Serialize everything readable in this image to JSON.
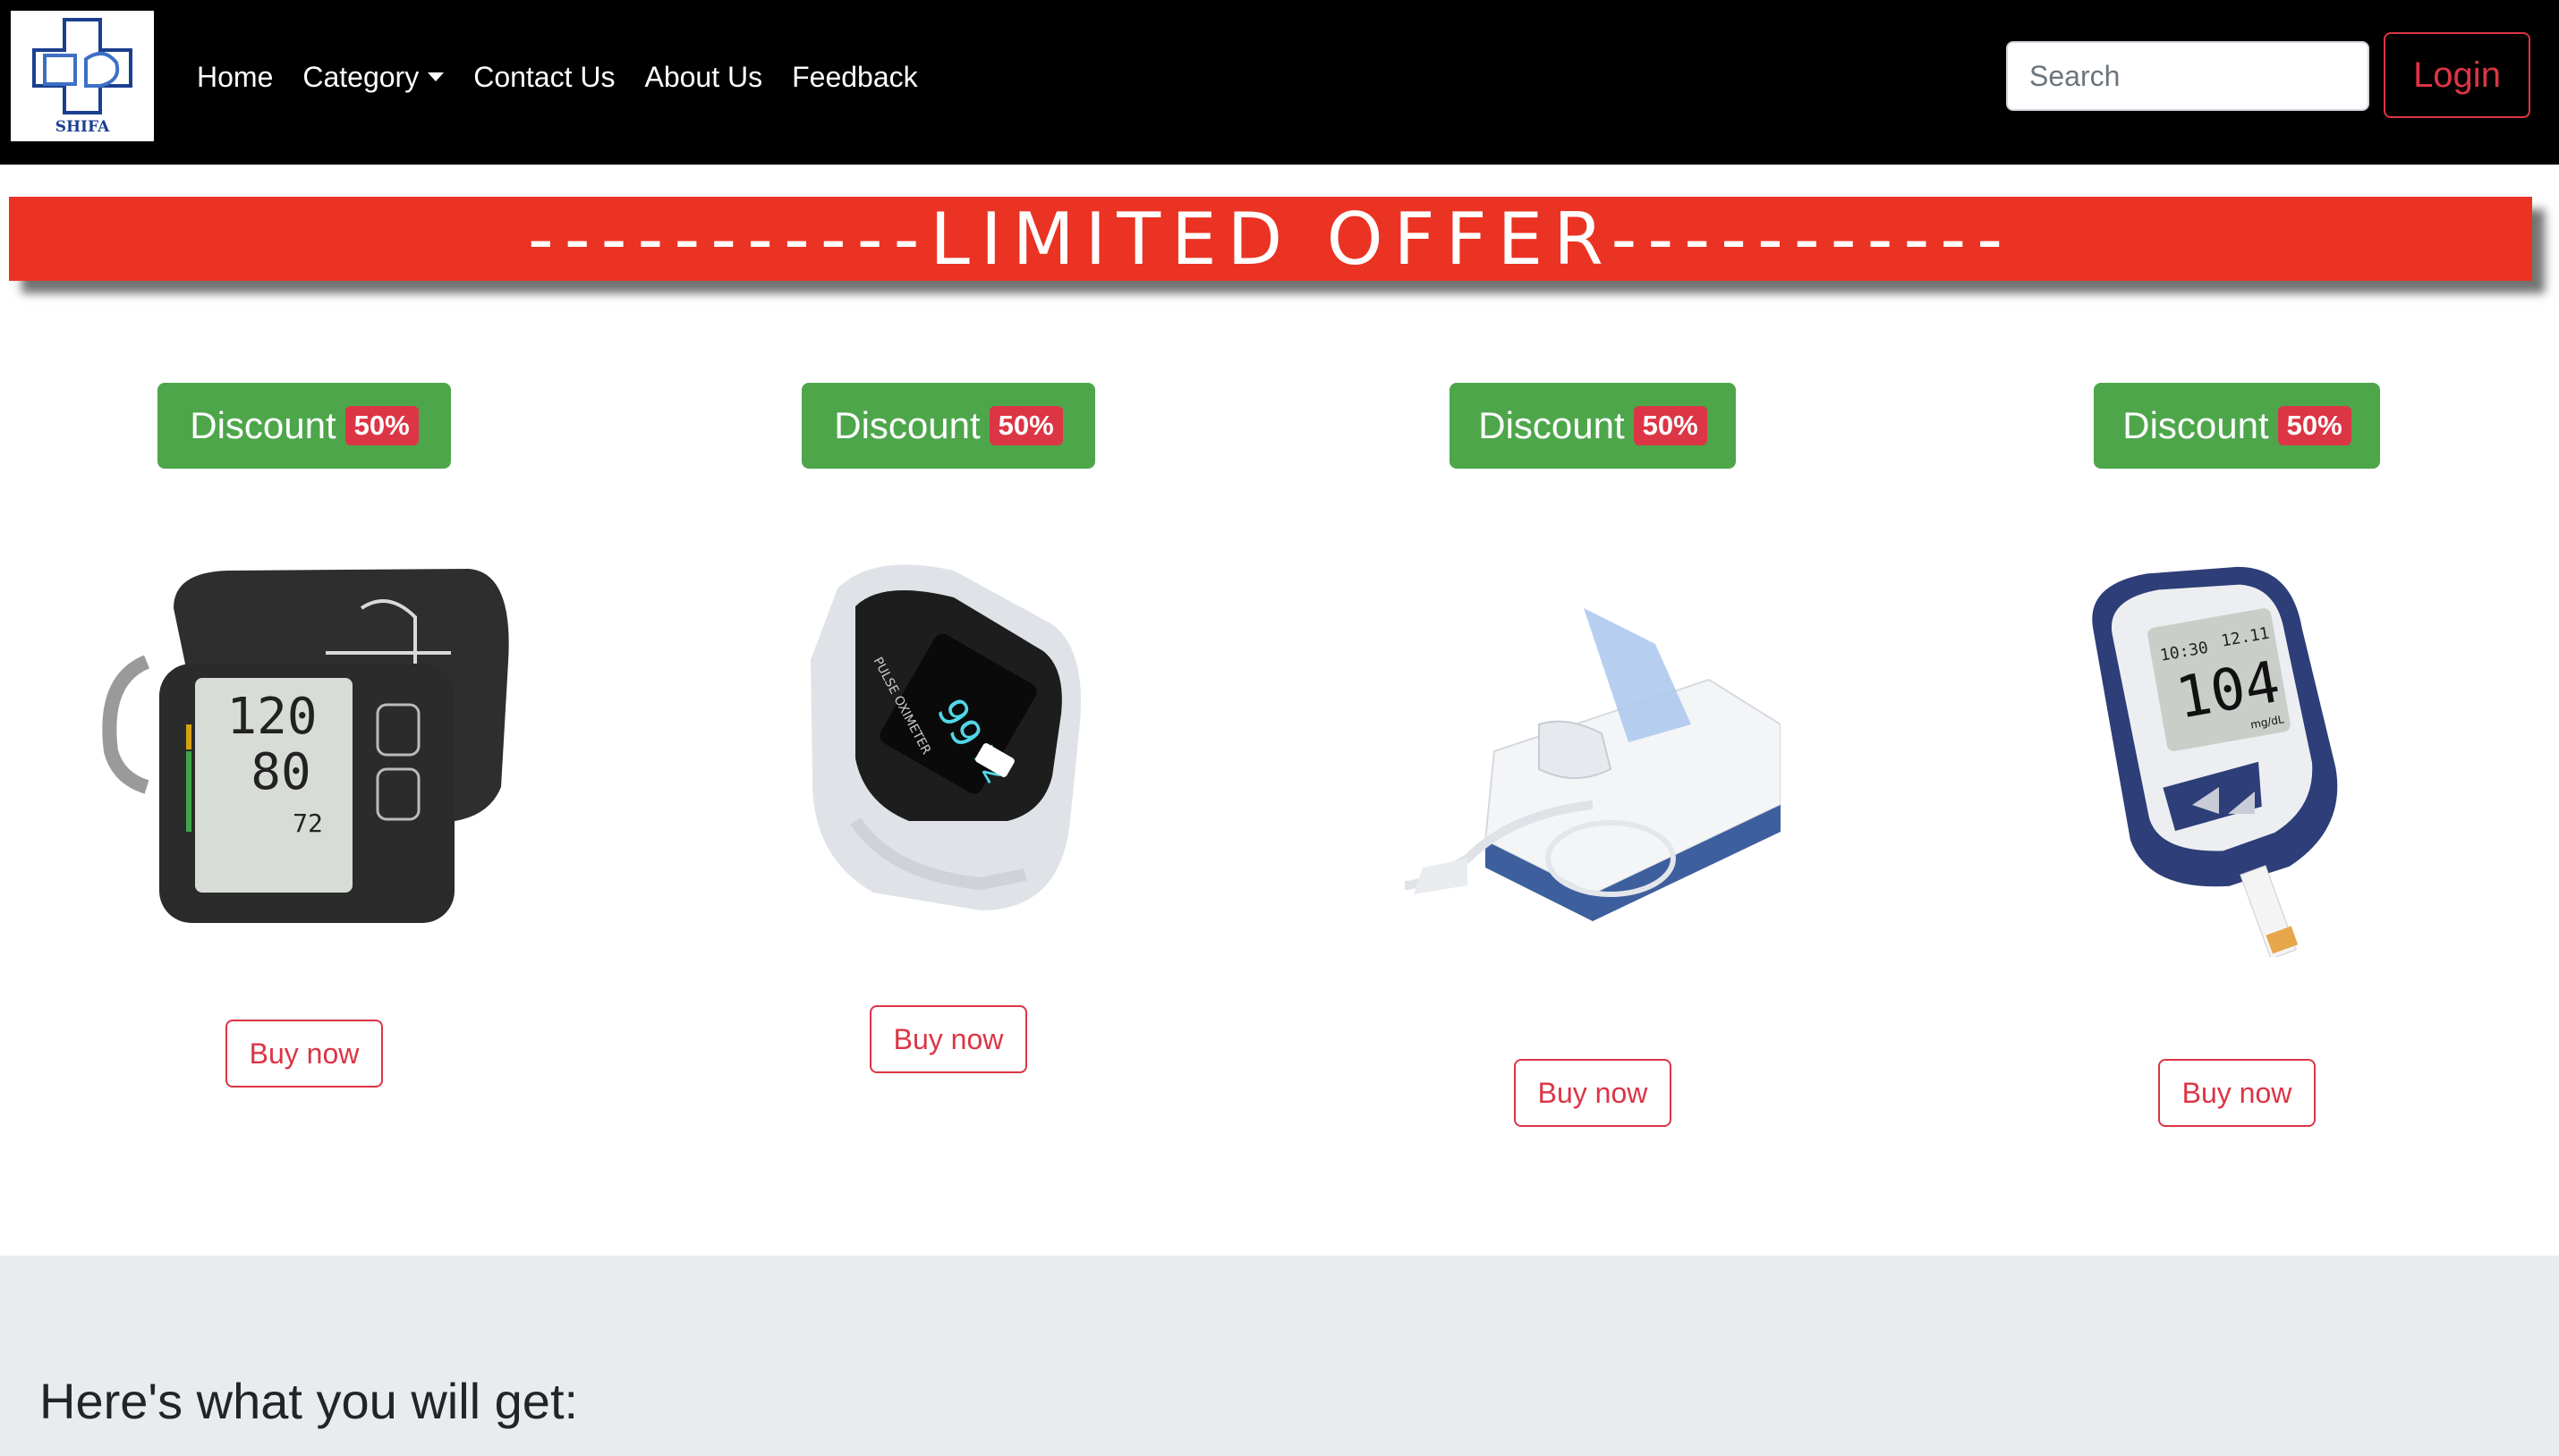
{
  "brand": {
    "logo_text": "SHIFA"
  },
  "nav": {
    "items": [
      "Home",
      "Category",
      "Contact Us",
      "About Us",
      "Feedback"
    ],
    "search_placeholder": "Search",
    "login_label": "Login"
  },
  "colors": {
    "navbar": "#000000",
    "banner": "#ea3323",
    "discount": "#4ea64b",
    "badge": "#dc3545",
    "accent": "#dc3545",
    "section_bg": "#e9ebef"
  },
  "banner": {
    "text": "-----------LIMITED OFFER-----------"
  },
  "products": [
    {
      "discount_label": "Discount",
      "discount_value": "50%",
      "buy_label": "Buy now",
      "image": "blood-pressure-monitor"
    },
    {
      "discount_label": "Discount",
      "discount_value": "50%",
      "buy_label": "Buy now",
      "image": "pulse-oximeter"
    },
    {
      "discount_label": "Discount",
      "discount_value": "50%",
      "buy_label": "Buy now",
      "image": "nebulizer"
    },
    {
      "discount_label": "Discount",
      "discount_value": "50%",
      "buy_label": "Buy now",
      "image": "glucometer"
    }
  ],
  "device_text": {
    "bp_sys": "120",
    "bp_dia": "80",
    "bp_pul": "72",
    "ox_spo2": "99",
    "ox_pr": "72",
    "ox_name": "PULSE OXIMETER",
    "gluco_time": "10:30",
    "gluco_date": "12.11",
    "gluco_value": "104",
    "gluco_unit": "mg/dL"
  },
  "section": {
    "title": "Here's what you will get:"
  }
}
